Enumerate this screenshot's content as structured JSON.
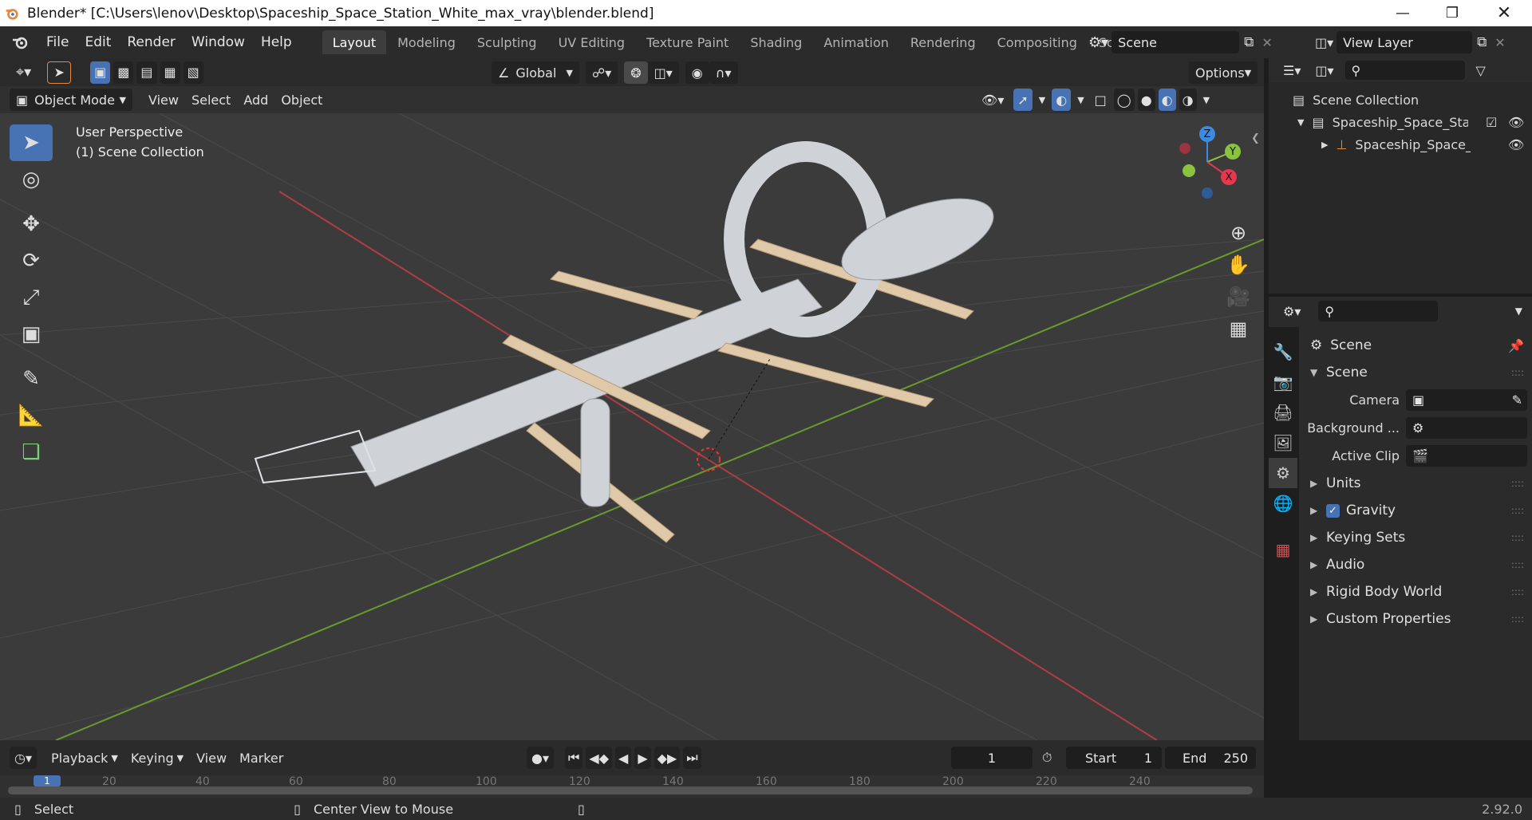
{
  "window": {
    "title": "Blender* [C:\\Users\\lenov\\Desktop\\Spaceship_Space_Station_White_max_vray\\blender.blend]"
  },
  "menu": [
    "File",
    "Edit",
    "Render",
    "Window",
    "Help"
  ],
  "workspaces": [
    "Layout",
    "Modeling",
    "Sculpting",
    "UV Editing",
    "Texture Paint",
    "Shading",
    "Animation",
    "Rendering",
    "Compositing",
    "Scripting"
  ],
  "active_workspace": "Layout",
  "scene_field": "Scene",
  "view_layer_field": "View Layer",
  "viewport": {
    "transform_orientation": "Global",
    "options_label": "Options",
    "mode": "Object Mode",
    "header_menus": [
      "View",
      "Select",
      "Add",
      "Object"
    ],
    "overlay_line1": "User Perspective",
    "overlay_line2": "(1) Scene Collection",
    "gizmo_axes": {
      "z": "Z",
      "y": "Y",
      "x": "X"
    }
  },
  "outliner": {
    "root": "Scene Collection",
    "item1": "Spaceship_Space_Station",
    "item2": "Spaceship_Space_Sta"
  },
  "properties": {
    "context": "Scene",
    "panel": "Scene",
    "camera_label": "Camera",
    "background_label": "Background ...",
    "active_clip_label": "Active Clip",
    "sections": [
      "Units",
      "Gravity",
      "Keying Sets",
      "Audio",
      "Rigid Body World",
      "Custom Properties"
    ],
    "gravity_enabled": true
  },
  "timeline": {
    "menus": [
      "Playback",
      "Keying",
      "View",
      "Marker"
    ],
    "current_frame": "1",
    "start_label": "Start",
    "start": "1",
    "end_label": "End",
    "end": "250",
    "ruler": [
      "1",
      "20",
      "40",
      "60",
      "80",
      "100",
      "120",
      "140",
      "160",
      "180",
      "200",
      "220",
      "240"
    ]
  },
  "status": {
    "left": "Select",
    "middle": "Center View to Mouse",
    "version": "2.92.0"
  },
  "colors": {
    "accent": "#4772b3",
    "x_axis": "#e8364f",
    "y_axis": "#8ac43f",
    "z_axis": "#3d8ae0",
    "orange": "#e8873a"
  }
}
